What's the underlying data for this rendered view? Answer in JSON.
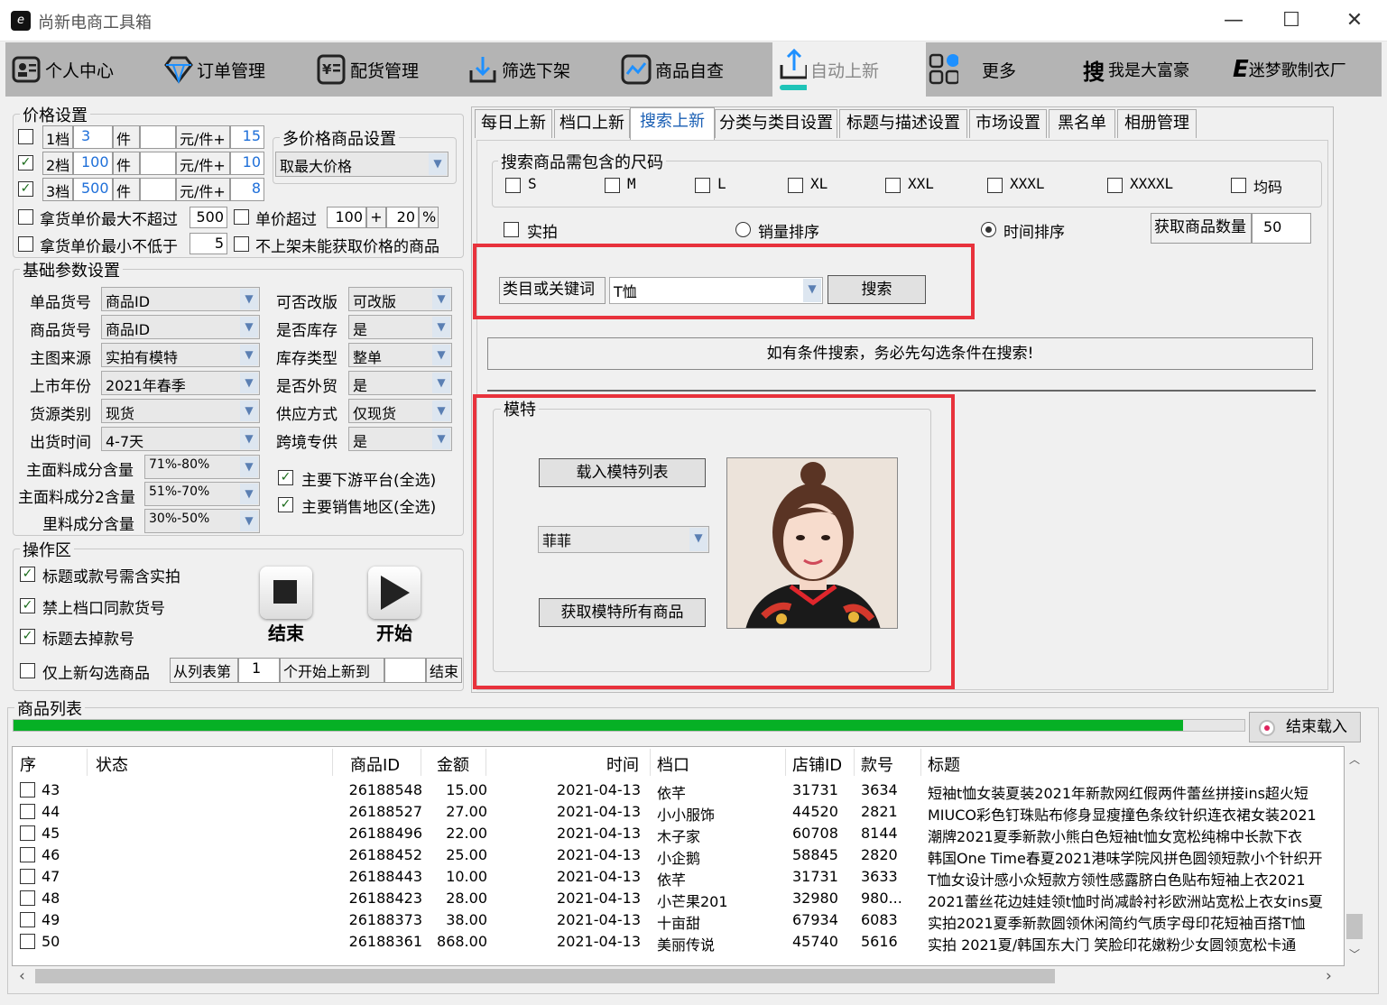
{
  "window": {
    "title": "尚新电商工具箱",
    "icon": "e",
    "min": "—",
    "max": "☐",
    "close": "✕"
  },
  "nav": [
    {
      "label": "个人中心",
      "icon": "user-card-icon"
    },
    {
      "label": "订单管理",
      "icon": "diamond-icon"
    },
    {
      "label": "配货管理",
      "icon": "yen-doc-icon"
    },
    {
      "label": "筛选下架",
      "icon": "download-icon"
    },
    {
      "label": "商品自查",
      "icon": "chart-icon"
    },
    {
      "label": "自动上新",
      "icon": "upload-icon"
    },
    {
      "label": "更多",
      "icon": "grid-icon"
    },
    {
      "label": "我是大富豪",
      "prefix": "搜"
    },
    {
      "label": "迷梦歌制衣厂",
      "prefix": "E"
    }
  ],
  "price": {
    "title": "价格设置",
    "tiers": [
      {
        "name": "1档",
        "qty": "3",
        "unit": "件",
        "price": "",
        "per": "元/件+",
        "add": "15",
        "checked": false
      },
      {
        "name": "2档",
        "qty": "100",
        "unit": "件",
        "price": "",
        "per": "元/件+",
        "add": "10",
        "checked": true
      },
      {
        "name": "3档",
        "qty": "500",
        "unit": "件",
        "price": "",
        "per": "元/件+",
        "add": "8",
        "checked": true
      }
    ],
    "multi_title": "多价格商品设置",
    "multi_value": "取最大价格",
    "max_label": "拿货单价最大不超过",
    "max_value": "500",
    "over_label": "单价超过",
    "over_value": "100",
    "plus": "+",
    "pct_value": "20",
    "pct": "%",
    "min_label": "拿货单价最小不低于",
    "min_value": "5",
    "skip_label": "不上架未能获取价格的商品"
  },
  "basic": {
    "title": "基础参数设置",
    "left": [
      {
        "label": "单品货号",
        "value": "商品ID"
      },
      {
        "label": "商品货号",
        "value": "商品ID"
      },
      {
        "label": "主图来源",
        "value": "实拍有模特"
      },
      {
        "label": "上市年份",
        "value": "2021年春季"
      },
      {
        "label": "货源类别",
        "value": "现货"
      },
      {
        "label": "出货时间",
        "value": "4-7天"
      }
    ],
    "right": [
      {
        "label": "可否改版",
        "value": "可改版"
      },
      {
        "label": "是否库存",
        "value": "是"
      },
      {
        "label": "库存类型",
        "value": "整单"
      },
      {
        "label": "是否外贸",
        "value": "是"
      },
      {
        "label": "供应方式",
        "value": "仅现货"
      },
      {
        "label": "跨境专供",
        "value": "是"
      }
    ],
    "fabric": [
      {
        "label": "主面料成分含量",
        "value": "71%-80%"
      },
      {
        "label": "主面料成分2含量",
        "value": "51%-70%"
      },
      {
        "label": "里料成分含量",
        "value": "30%-50%"
      }
    ],
    "platform": "主要下游平台(全选)",
    "region": "主要销售地区(全选)"
  },
  "ops": {
    "title": "操作区",
    "c1": "标题或款号需含实拍",
    "c2": "禁上档口同款货号",
    "c3": "标题去掉款号",
    "stop": "结束",
    "start": "开始",
    "only": "仅上新勾选商品",
    "from": "从列表第",
    "from_value": "1",
    "to": "个开始上新到",
    "to_value": "",
    "end": "结束"
  },
  "tabs": [
    "每日上新",
    "档口上新",
    "搜索上新",
    "分类与类目设置",
    "标题与描述设置",
    "市场设置",
    "黑名单",
    "相册管理"
  ],
  "search": {
    "sizes_title": "搜索商品需包含的尺码",
    "sizes": [
      "S",
      "M",
      "L",
      "XL",
      "XXL",
      "XXXL",
      "XXXXL",
      "均码"
    ],
    "real": "实拍",
    "sales": "销量排序",
    "time": "时间排序",
    "count_label": "获取商品数量",
    "count_value": "50",
    "kw_label": "类目或关键词",
    "kw_value": "T恤",
    "search_btn": "搜索",
    "notice": "如有条件搜索，务必先勾选条件在搜索!"
  },
  "model": {
    "title": "模特",
    "load": "载入模特列表",
    "name": "菲菲",
    "fetch": "获取模特所有商品"
  },
  "list": {
    "title": "商品列表",
    "stop_load": "结束载入",
    "progress": 0.95,
    "headers": [
      "序",
      "状态",
      "商品ID",
      "金额",
      "时间",
      "档口",
      "店铺ID",
      "款号",
      "标题"
    ],
    "rows": [
      [
        "43",
        "",
        "26188548",
        "15.00",
        "2021-04-13",
        "依芊",
        "31731",
        "3634",
        "短袖t恤女装夏装2021年新款网红假两件蕾丝拼接ins超火短"
      ],
      [
        "44",
        "",
        "26188527",
        "27.00",
        "2021-04-13",
        "小小服饰",
        "44520",
        "2821",
        "MIUCO彩色钉珠贴布修身显瘦撞色条纹针织连衣裙女装2021"
      ],
      [
        "45",
        "",
        "26188496",
        "22.00",
        "2021-04-13",
        "木子家",
        "60708",
        "8144",
        "潮牌2021夏季新款小熊白色短袖t恤女宽松纯棉中长款下衣"
      ],
      [
        "46",
        "",
        "26188452",
        "25.00",
        "2021-04-13",
        "小企鹅",
        "58845",
        "2820",
        "韩国One Time春夏2021港味学院风拼色圆领短款小个针织开"
      ],
      [
        "47",
        "",
        "26188443",
        "10.00",
        "2021-04-13",
        "依芊",
        "31731",
        "3633",
        "T恤女设计感小众短款方领性感露脐白色贴布短袖上衣2021"
      ],
      [
        "48",
        "",
        "26188423",
        "28.00",
        "2021-04-13",
        "小芒果201",
        "32980",
        "980...",
        "2021蕾丝花边娃娃领t恤时尚减龄衬衫欧洲站宽松上衣女ins夏"
      ],
      [
        "49",
        "",
        "26188373",
        "38.00",
        "2021-04-13",
        "十亩甜",
        "67934",
        "6083",
        "实拍2021夏季新款圆领休闲简约气质字母印花短袖百搭T恤"
      ],
      [
        "50",
        "",
        "26188361",
        "868.00",
        "2021-04-13",
        "美丽传说",
        "45740",
        "5616",
        "实拍 2021夏/韩国东大门 笑脸印花嫩粉少女圆领宽松卡通"
      ]
    ]
  }
}
